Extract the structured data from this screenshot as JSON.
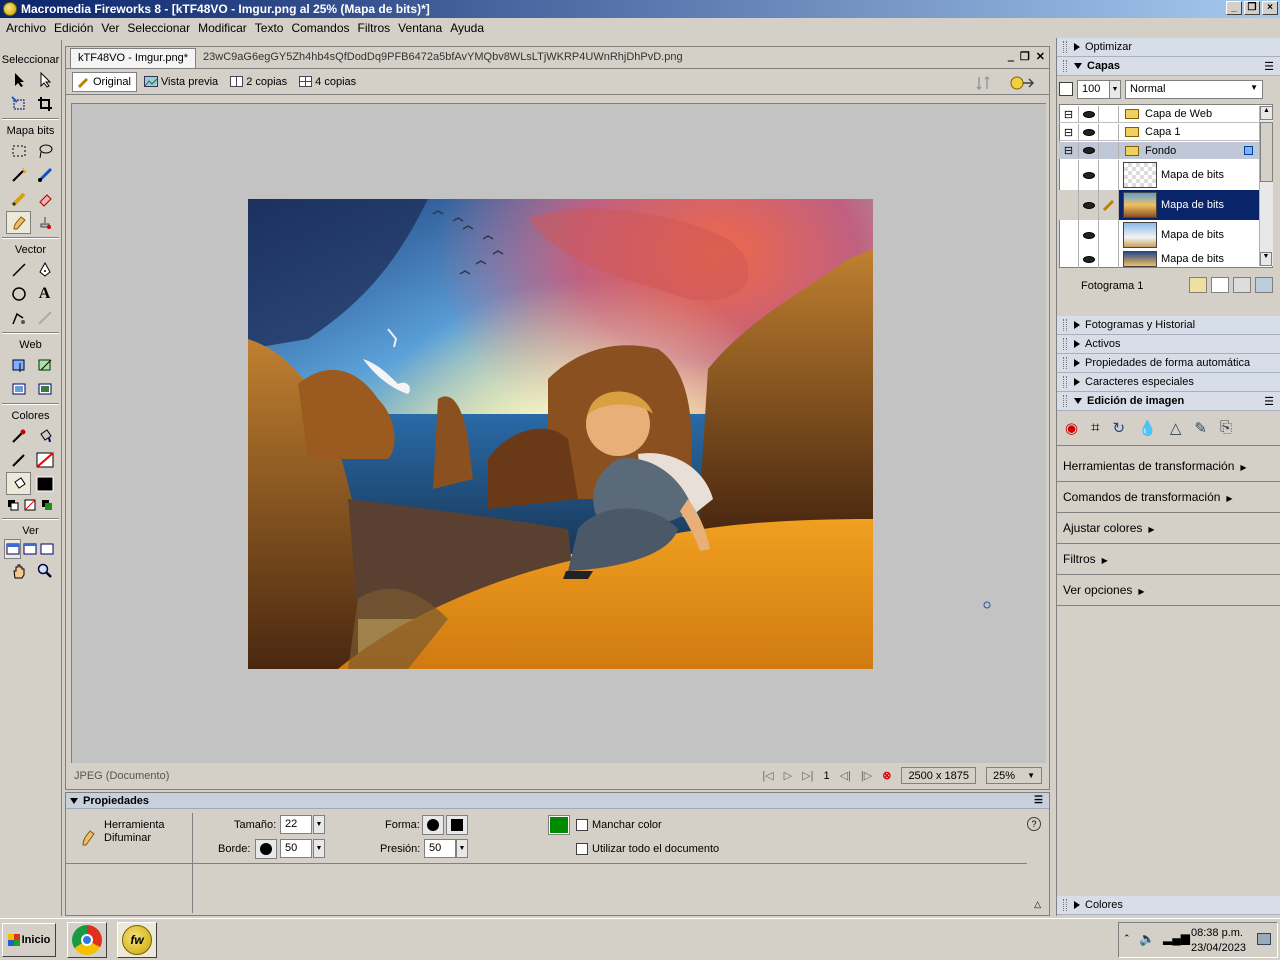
{
  "window": {
    "title": "Macromedia Fireworks 8 - [kTF48VO - Imgur.png al  25% (Mapa de bits)*]"
  },
  "menu": [
    "Archivo",
    "Edición",
    "Ver",
    "Seleccionar",
    "Modificar",
    "Texto",
    "Comandos",
    "Filtros",
    "Ventana",
    "Ayuda"
  ],
  "toolbox": {
    "sections": {
      "select": "Seleccionar",
      "bitmap": "Mapa bits",
      "vector": "Vector",
      "web": "Web",
      "colors": "Colores",
      "view": "Ver"
    }
  },
  "document": {
    "tabs": [
      "kTF48VO - Imgur.png*",
      "23wC9aG6egGY5Zh4hb4sQfDodDq9PFB6472a5bfAvYMQbv8WLsLTjWKRP4UWnRhjDhPvD.png"
    ],
    "views": [
      "Original",
      "Vista previa",
      "2 copias",
      "4 copias"
    ],
    "status_left": "JPEG (Documento)",
    "frame": "1",
    "size": "2500 x 1875",
    "zoom": "25%"
  },
  "properties": {
    "title": "Propiedades",
    "tool_name": "Herramienta Difuminar",
    "size_label": "Tamaño:",
    "size_value": "22",
    "edge_label": "Borde:",
    "edge_value": "50",
    "shape_label": "Forma:",
    "pressure_label": "Presión:",
    "pressure_value": "50",
    "smudge_color": "Manchar color",
    "use_whole_doc": "Utilizar todo el documento",
    "color": "#008a00"
  },
  "right_panel": {
    "optimize": "Optimizar",
    "layers_title": "Capas",
    "opacity": "100",
    "blend": "Normal",
    "layers": [
      "Capa de Web",
      "Capa 1",
      "Fondo"
    ],
    "objects": [
      "Mapa de bits",
      "Mapa de bits",
      "Mapa de bits",
      "Mapa de bits"
    ],
    "frame_label": "Fotograma 1",
    "collapsed": [
      "Fotogramas y Historial",
      "Activos",
      "Propiedades de forma automática",
      "Caracteres especiales"
    ],
    "image_edit": "Edición de imagen",
    "image_menu": [
      "Herramientas de transformación",
      "Comandos de transformación",
      "Ajustar colores",
      "Filtros",
      "Ver opciones"
    ],
    "colors": "Colores"
  },
  "taskbar": {
    "start": "Inicio",
    "time": "08:38 p.m.",
    "date": "23/04/2023"
  }
}
